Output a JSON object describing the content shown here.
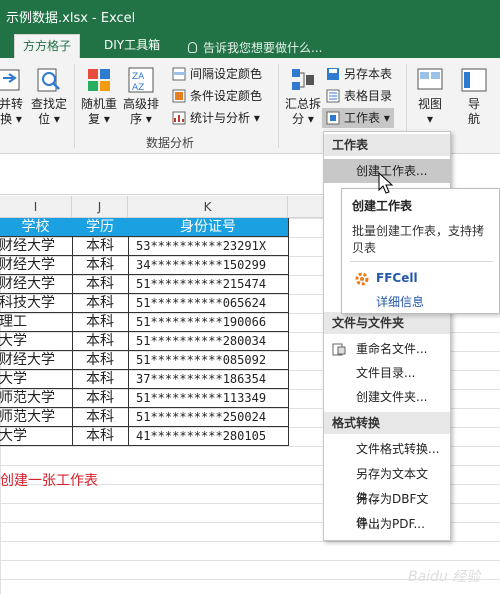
{
  "titlebar": {
    "title": "示例数据.xlsx - Excel"
  },
  "tabs": [
    {
      "label": "方方格子",
      "active": true
    },
    {
      "label": "DIY工具箱",
      "active": false
    }
  ],
  "tell_me": "告诉我您想要做什么...",
  "ribbon": {
    "big_buttons": [
      {
        "label1": "并转",
        "label2": "换 ▾"
      },
      {
        "label1": "查找定",
        "label2": "位 ▾"
      },
      {
        "label1": "随机重",
        "label2": "复 ▾"
      },
      {
        "label1": "高级排",
        "label2": "序 ▾"
      },
      {
        "label1": "汇总拆",
        "label2": "分 ▾"
      },
      {
        "label1": "视图",
        "label2": "▾"
      },
      {
        "label1": "导",
        "label2": "航"
      }
    ],
    "small_buttons": {
      "interval_color": "间隔设定颜色",
      "cond_color": "条件设定颜色",
      "stats": "统计与分析 ▾",
      "save_as_book": "另存本表",
      "sheet_dir": "表格目录",
      "worksheet": "工作表 ▾"
    },
    "group_label": "数据分析"
  },
  "columns": {
    "i": "I",
    "j": "J",
    "k": "K"
  },
  "table": {
    "headers": [
      "学校",
      "学历",
      "身份证号"
    ],
    "rows": [
      [
        "财经大学",
        "本科",
        "53**********23291X"
      ],
      [
        "财经大学",
        "本科",
        "34**********150299"
      ],
      [
        "财经大学",
        "本科",
        "51**********215474"
      ],
      [
        "科技大学",
        "本科",
        "51**********065624"
      ],
      [
        "理工",
        "本科",
        "51**********190066"
      ],
      [
        "大学",
        "本科",
        "51**********280034"
      ],
      [
        "财经大学",
        "本科",
        "51**********085092"
      ],
      [
        "大学",
        "本科",
        "37**********186354"
      ],
      [
        "师范大学",
        "本科",
        "51**********113349"
      ],
      [
        "师范大学",
        "本科",
        "51**********250024"
      ],
      [
        "大学",
        "本科",
        "41**********280105"
      ]
    ]
  },
  "note": "创建一张工作表",
  "dropdown": {
    "section_sheet": "工作表",
    "create_sheet": "创建工作表...",
    "section_file": "文件与文件夹",
    "rename_file": "重命名文件...",
    "file_dir": "文件目录...",
    "create_folder": "创建文件夹...",
    "section_format": "格式转换",
    "file_format": "文件格式转换...",
    "save_as_text": "另存为文本文件...",
    "save_as_dbf": "另存为DBF文件...",
    "export_pdf": "导出为PDF..."
  },
  "tooltip": {
    "title": "创建工作表",
    "desc": "批量创建工作表，支持拷贝表",
    "brand": "FFCell",
    "more": "详细信息"
  },
  "watermark": "Baidu 经验",
  "colors": {
    "excel_green": "#217346",
    "header_blue": "#1ba1e2",
    "note_red": "#d9202c"
  }
}
